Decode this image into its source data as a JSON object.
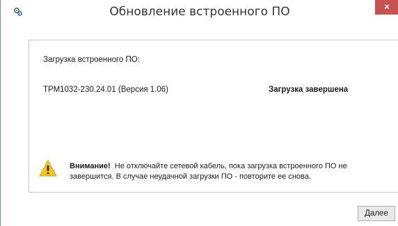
{
  "window": {
    "title": "Обновление встроенного ПО",
    "app_icon": "gear-icon",
    "close_label": "×"
  },
  "main": {
    "section_label": "Загрузка встроенного ПО:",
    "device": {
      "name": "ТРМ1032-230.24.01 (Версия 1.06)",
      "status": "Загрузка завершена"
    },
    "warning": {
      "icon": "warning-icon",
      "title": "Внимание!",
      "message": "Не отключайте сетевой кабель, пока загрузка встроенного ПО не завершится. В случае неудачной загрузки ПО - повторите ее снова."
    }
  },
  "footer": {
    "next_label": "Далее"
  },
  "colors": {
    "close_button": "#c75050",
    "warning_fill": "#f5c518",
    "window_border": "#6a8bb5"
  }
}
